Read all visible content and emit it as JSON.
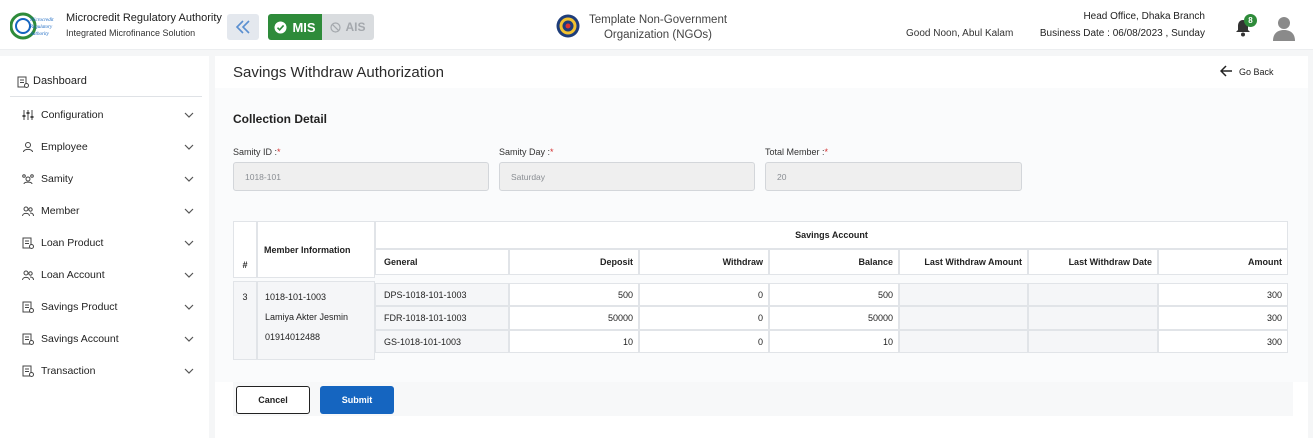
{
  "header": {
    "logo_text": [
      "Microcredit",
      "Regulatory",
      "Authority"
    ],
    "org_name": "Microcredit Regulatory Authority",
    "org_subtitle": "Integrated Microfinance Solution",
    "mis_label": "MIS",
    "ais_label": "AIS",
    "ngo_name_line1": "Template Non-Government",
    "ngo_name_line2": "Organization (NGOs)",
    "greeting": "Good Noon, Abul Kalam",
    "branch": "Head Office, Dhaka Branch",
    "business_date": "Business Date : 06/08/2023 , Sunday",
    "notification_count": "8",
    "mis_color": "#2e8b3a",
    "accent_color": "#1565c0"
  },
  "sidebar": {
    "dashboard": "Dashboard",
    "items": [
      {
        "label": "Configuration",
        "icon": "sliders-icon"
      },
      {
        "label": "Employee",
        "icon": "employee-icon"
      },
      {
        "label": "Samity",
        "icon": "group-icon"
      },
      {
        "label": "Member",
        "icon": "members-icon"
      },
      {
        "label": "Loan Product",
        "icon": "document-icon"
      },
      {
        "label": "Loan Account",
        "icon": "members-icon"
      },
      {
        "label": "Savings Product",
        "icon": "document-icon"
      },
      {
        "label": "Savings Account",
        "icon": "document-icon"
      },
      {
        "label": "Transaction",
        "icon": "document-icon"
      }
    ]
  },
  "page": {
    "title": "Savings Withdraw Authorization",
    "go_back": "Go Back",
    "section_title": "Collection Detail"
  },
  "fields": {
    "samity_id": {
      "label": "Samity ID :",
      "required": "*",
      "value": "1018-101"
    },
    "samity_day": {
      "label": "Samity Day :",
      "required": "*",
      "value": "Saturday"
    },
    "total_member": {
      "label": "Total Member :",
      "required": "*",
      "value": "20"
    }
  },
  "table": {
    "col_hash": "#",
    "col_member_info": "Member Information",
    "group_header": "Savings Account",
    "headers": [
      "General",
      "Deposit",
      "Withdraw",
      "Balance",
      "Last Withdraw Amount",
      "Last Withdraw Date",
      "Amount"
    ],
    "member": {
      "index": "3",
      "code": "1018-101-1003",
      "name": "Lamiya Akter Jesmin",
      "phone": "01914012488"
    },
    "rows": [
      [
        "DPS-1018-101-1003",
        "500",
        "0",
        "500",
        "",
        "",
        "300"
      ],
      [
        "FDR-1018-101-1003",
        "50000",
        "0",
        "50000",
        "",
        "",
        "300"
      ],
      [
        "GS-1018-101-1003",
        "10",
        "0",
        "10",
        "",
        "",
        "300"
      ]
    ]
  },
  "actions": {
    "cancel": "Cancel",
    "submit": "Submit"
  }
}
